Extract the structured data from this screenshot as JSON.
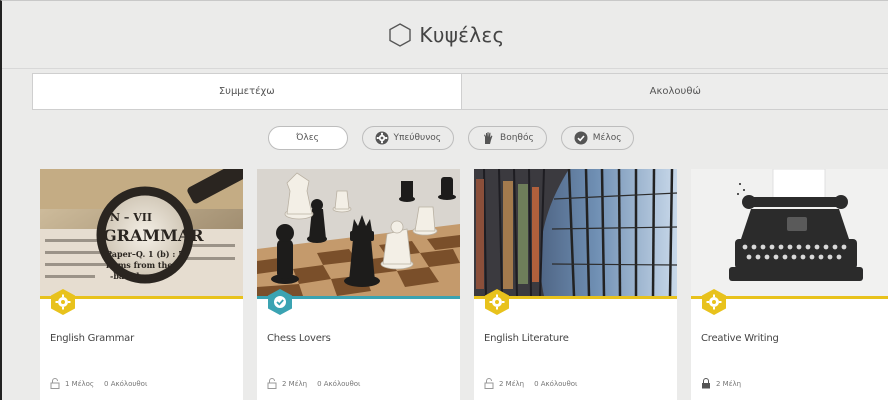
{
  "header": {
    "title": "Κυψέλες",
    "icon": "hexagon-icon"
  },
  "tabs": [
    {
      "label": "Συμμετέχω",
      "active": true
    },
    {
      "label": "Ακολουθώ",
      "active": false
    }
  ],
  "filters": [
    {
      "label": "Όλες",
      "icon": "",
      "active": true
    },
    {
      "label": "Υπεύθυνος",
      "icon": "gear-icon",
      "active": false
    },
    {
      "label": "Βοηθός",
      "icon": "hand-icon",
      "active": false
    },
    {
      "label": "Μέλος",
      "icon": "check-circle-icon",
      "active": false
    }
  ],
  "colors": {
    "yellow": "#e8c21c",
    "teal": "#3aa3b2",
    "background": "#ebebea"
  },
  "cards": [
    {
      "name": "English Grammar",
      "members": "1 Μέλος",
      "followers": "0 Ακόλουθοι",
      "role": "gear-icon",
      "accent": "#e8c21c",
      "lock": "open-lock-icon"
    },
    {
      "name": "Chess Lovers",
      "members": "2 Μέλη",
      "followers": "0 Ακόλουθοι",
      "role": "check-icon",
      "accent": "#3aa3b2",
      "lock": "open-lock-icon"
    },
    {
      "name": "English Literature",
      "members": "2 Μέλη",
      "followers": "0 Ακόλουθοι",
      "role": "gear-icon",
      "accent": "#e8c21c",
      "lock": "open-lock-icon"
    },
    {
      "name": "Creative Writing",
      "members": "2 Μέλη",
      "followers": "",
      "role": "gear-icon",
      "accent": "#e8c21c",
      "lock": "closed-lock-icon"
    }
  ]
}
